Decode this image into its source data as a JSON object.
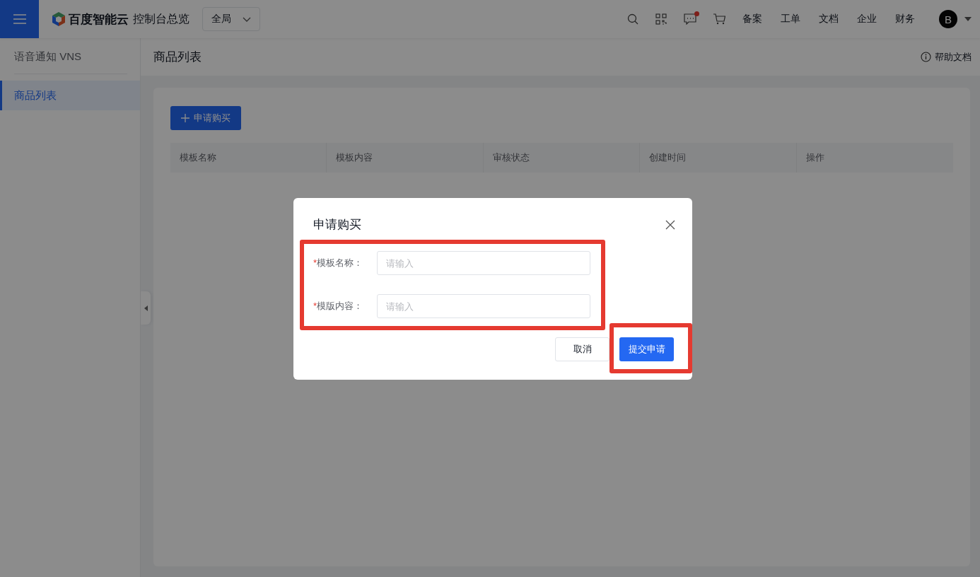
{
  "topbar": {
    "brand": "百度智能云",
    "console": "控制台总览",
    "region": "全局",
    "notification_dot": true,
    "links": [
      "备案",
      "工单",
      "文档",
      "企业",
      "财务"
    ],
    "avatar": "B"
  },
  "sidebar": {
    "title": "语音通知 VNS",
    "items": [
      {
        "label": "商品列表",
        "selected": true
      }
    ]
  },
  "page": {
    "title": "商品列表",
    "help": "帮助文档",
    "add_button": "申请购买",
    "table": {
      "columns": [
        "模板名称",
        "模板内容",
        "审核状态",
        "创建时间",
        "操作"
      ]
    }
  },
  "dialog": {
    "title": "申请购买",
    "highlighted": true,
    "fields": [
      {
        "required_mark": "*",
        "label": "模板名称：",
        "placeholder": "请输入"
      },
      {
        "required_mark": "*",
        "label": "模版内容：",
        "placeholder": "请输入"
      }
    ],
    "buttons": [
      {
        "label": "取消",
        "kind": "default",
        "highlighted": false
      },
      {
        "label": "提交申请",
        "kind": "primary",
        "highlighted": true
      }
    ]
  }
}
